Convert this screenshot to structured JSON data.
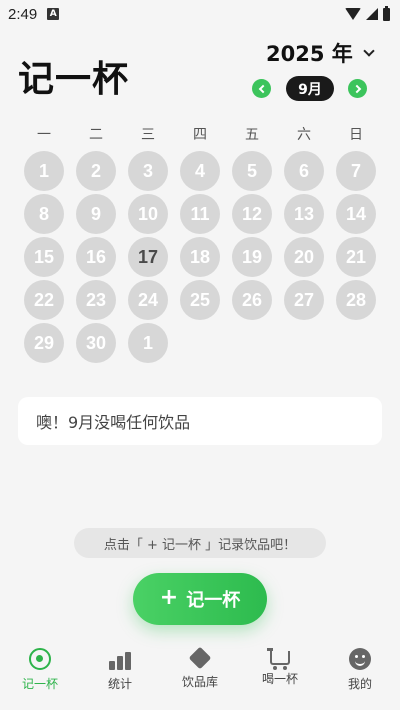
{
  "status_bar": {
    "time": "2:49",
    "notification_icon": "A"
  },
  "header": {
    "title": "记一杯",
    "year": "2025 年",
    "month": "9月"
  },
  "calendar": {
    "weekdays": [
      "一",
      "二",
      "三",
      "四",
      "五",
      "六",
      "日"
    ],
    "days": [
      "1",
      "2",
      "3",
      "4",
      "5",
      "6",
      "7",
      "8",
      "9",
      "10",
      "11",
      "12",
      "13",
      "14",
      "15",
      "16",
      "17",
      "18",
      "19",
      "20",
      "21",
      "22",
      "23",
      "24",
      "25",
      "26",
      "27",
      "28",
      "29",
      "30",
      "1"
    ],
    "today": "17"
  },
  "empty_message": "噢！9月没喝任何饮品",
  "hint": "点击「 + 记一杯 」记录饮品吧！",
  "add_button": {
    "icon": "plus",
    "label": "记一杯"
  },
  "bottom_nav": [
    {
      "label": "记一杯",
      "icon": "record-icon",
      "active": true
    },
    {
      "label": "统计",
      "icon": "stats-icon",
      "active": false
    },
    {
      "label": "饮品库",
      "icon": "box-icon",
      "active": false
    },
    {
      "label": "喝一杯",
      "icon": "cart-icon",
      "active": false
    },
    {
      "label": "我的",
      "icon": "face-icon",
      "active": false
    }
  ],
  "colors": {
    "accent": "#3cc45c",
    "day_circle": "#d7d7d7",
    "pill": "#1a1a1a"
  }
}
